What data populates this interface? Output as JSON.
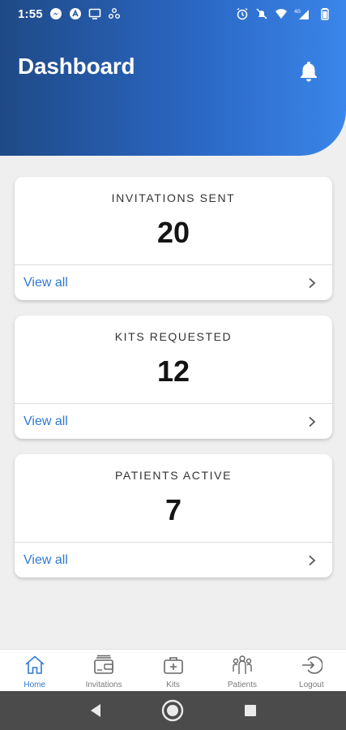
{
  "status_bar": {
    "time": "1:55",
    "left_icons": [
      "messenger-icon",
      "vpn-icon",
      "screen-icon",
      "app-icon"
    ],
    "right_icons": [
      "alarm-icon",
      "mute-icon",
      "wifi-icon",
      "signal-icon",
      "battery-icon"
    ],
    "network": "4G"
  },
  "header": {
    "title": "Dashboard",
    "bell_icon": "bell-icon"
  },
  "colors": {
    "header_start": "#1f4a86",
    "header_end": "#3a86ea",
    "accent": "#2f78d6"
  },
  "cards": [
    {
      "title": "INVITATIONS SENT",
      "value": "20",
      "link": "View all"
    },
    {
      "title": "KITS REQUESTED",
      "value": "12",
      "link": "View all"
    },
    {
      "title": "PATIENTS ACTIVE",
      "value": "7",
      "link": "View all"
    }
  ],
  "bottom_nav": [
    {
      "label": "Home",
      "icon": "home-icon",
      "active": true
    },
    {
      "label": "Invitations",
      "icon": "wallet-icon",
      "active": false
    },
    {
      "label": "Kits",
      "icon": "medkit-icon",
      "active": false
    },
    {
      "label": "Patients",
      "icon": "people-icon",
      "active": false
    },
    {
      "label": "Logout",
      "icon": "logout-icon",
      "active": false
    }
  ],
  "system_nav": [
    "back-icon",
    "home-circle-icon",
    "recents-icon"
  ]
}
